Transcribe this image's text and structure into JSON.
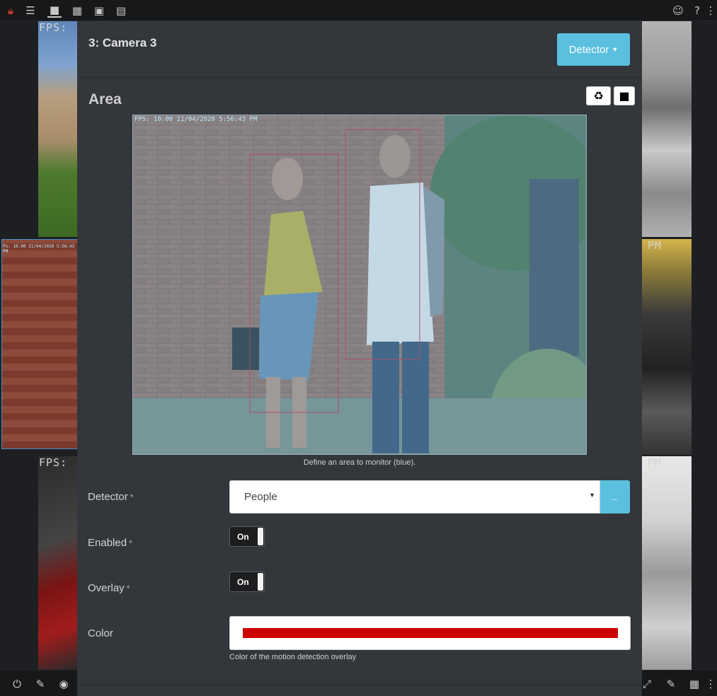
{
  "colors": {
    "accent": "#5bc0de",
    "overlay_color": "#cc0000",
    "modal_bg": "#33363b",
    "app_bg": "#1e1f22"
  },
  "topbar": {
    "icons": [
      "lock-icon",
      "server-icon",
      "video-camera-icon",
      "calendar-icon",
      "video-file-icon",
      "image-icon",
      "user-icon",
      "help-icon"
    ]
  },
  "tiles": {
    "fps_label": "FPS:",
    "pm_label": "PM",
    "timestamp": "Ps: 10.00 21/04/2020 5:56:43 PM"
  },
  "modal": {
    "title": "3: Camera 3",
    "detector_button": "Detector",
    "section_title": "Area",
    "refresh_icon": "♻",
    "stop_icon": "■",
    "preview_timestamp": "FPS: 10.00 21/04/2020 5:56:43 PM",
    "hint": "Define an area to monitor (blue).",
    "detector": {
      "label": "Detector",
      "required": "*",
      "value": "People",
      "more_button": "..."
    },
    "enabled": {
      "label": "Enabled",
      "required": "*",
      "value": "On"
    },
    "overlay": {
      "label": "Overlay",
      "required": "*",
      "value": "On"
    },
    "color": {
      "label": "Color",
      "help": "Color of the motion detection overlay"
    }
  },
  "bottombar": {
    "icons": [
      "power-icon",
      "edit-icon",
      "record-icon",
      "fullscreen-icon",
      "edit-layout-icon",
      "grid-icon",
      "more-icon"
    ]
  }
}
